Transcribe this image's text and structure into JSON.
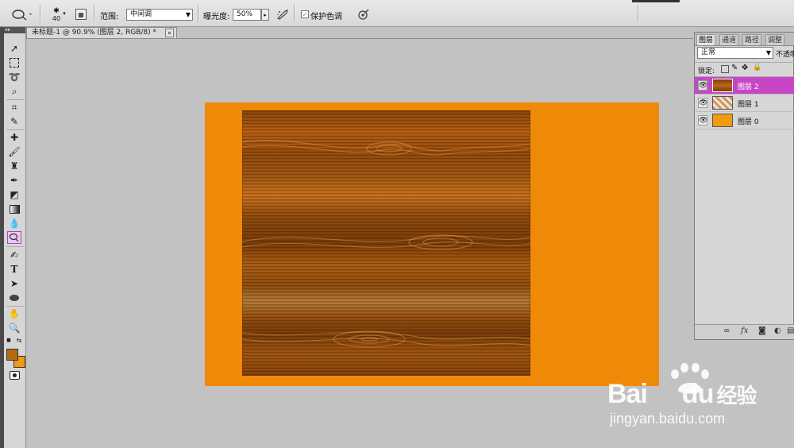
{
  "options_bar": {
    "brush_size": "40",
    "range_label": "范围:",
    "range_value": "中间调",
    "exposure_label": "曝光度:",
    "exposure_value": "50%",
    "protect_tones_label": "保护色调"
  },
  "document": {
    "tab_title": "未标题-1 @ 90.9% (图层 2, RGB/8) *",
    "close_glyph": "×"
  },
  "panel": {
    "tabs": [
      "图层",
      "通道",
      "路径",
      "调整"
    ],
    "blend_mode": "正常",
    "opacity_label": "不透明",
    "lock_label": "锁定:",
    "layers": [
      {
        "name": "图层 2",
        "selected": true
      },
      {
        "name": "图层 1",
        "selected": false
      },
      {
        "name": "图层 0",
        "selected": false
      }
    ]
  },
  "watermark": {
    "brand_text": "Bai",
    "brand_text2": "du",
    "brand_cn": "经验",
    "url": "jingyan.baidu.com"
  },
  "colors": {
    "canvas_orange": "#ef8a08",
    "selection_purple": "#c646c6",
    "foreground": "#b56a12",
    "background": "#f09a10"
  }
}
